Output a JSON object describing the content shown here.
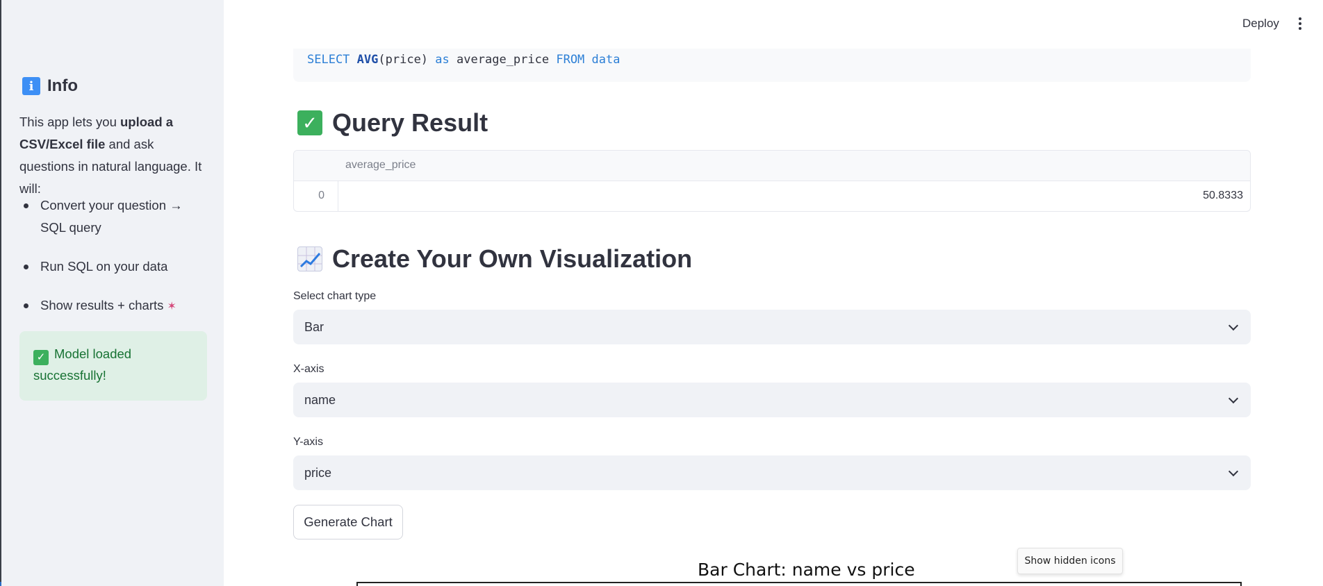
{
  "header": {
    "deploy_label": "Deploy",
    "menu_icon": "kebab-menu-icon"
  },
  "sidebar": {
    "heading": "Info",
    "heading_icon": "info-icon",
    "intro": {
      "part1": "This app lets you ",
      "bold1": "upload a CSV/Excel file",
      "part2": " and ask questions in natural language. It will:"
    },
    "items": [
      {
        "label": "Convert your question → SQL query"
      },
      {
        "label": "Run SQL on your data"
      },
      {
        "label": "Show results + charts",
        "icon": "party-popper-icon"
      }
    ],
    "status": {
      "text": "Model loaded successfully!",
      "icon": "check-mark-icon",
      "color": "#177233"
    }
  },
  "main": {
    "code": {
      "kw1": "SELECT",
      "fn": "AVG",
      "arg": "(price)",
      "kw2": "as",
      "alias": "average_price",
      "kw3": "FROM",
      "table": "data"
    },
    "query_result": {
      "heading": "Query Result",
      "icon": "check-mark-icon",
      "columns": [
        "average_price"
      ],
      "rows": [
        {
          "index": "0",
          "average_price": "50.8333"
        }
      ]
    },
    "visualization": {
      "heading": "Create Your Own Visualization",
      "icon": "chart-increasing-icon",
      "chart_type": {
        "label": "Select chart type",
        "value": "Bar"
      },
      "x_axis": {
        "label": "X-axis",
        "value": "name"
      },
      "y_axis": {
        "label": "Y-axis",
        "value": "price"
      },
      "generate_label": "Generate Chart",
      "chart_title": "Bar Chart: name vs price"
    }
  },
  "taskbar_tooltip": "Show hidden icons",
  "colors": {
    "accent": "#3cb05d",
    "sidebar_bg": "#f0f2f6",
    "keyword": "#2c7fd6"
  }
}
